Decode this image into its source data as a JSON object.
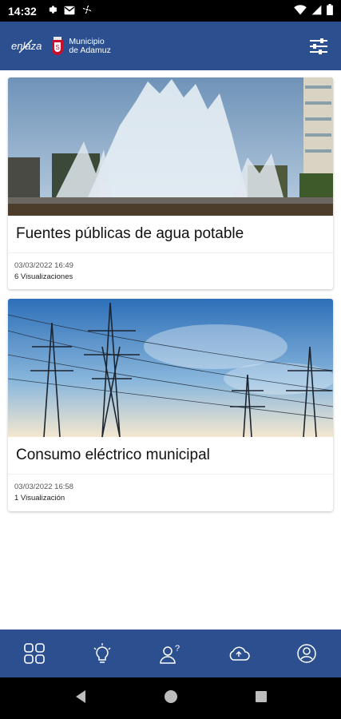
{
  "status_bar": {
    "time": "14:32",
    "left_icons": [
      "gear-icon",
      "gmail-icon",
      "fan-icon"
    ],
    "right_icons": [
      "wifi-icon",
      "signal-icon",
      "battery-icon"
    ]
  },
  "app_bar": {
    "logo_text": "enlaza",
    "municipality_line1": "Municipio",
    "municipality_line2": "de Adamuz",
    "filter_icon": "sliders-icon",
    "color": "#2b4f8f"
  },
  "cards": [
    {
      "image": "fountains-photo",
      "title": "Fuentes públicas de agua potable",
      "date": "03/03/2022 16:49",
      "views": "6 Visualizaciones"
    },
    {
      "image": "power-lines-photo",
      "title": "Consumo eléctrico municipal",
      "date": "03/03/2022 16:58",
      "views": "1 Visualización"
    }
  ],
  "bottom_nav": {
    "items": [
      "grid-icon",
      "lightbulb-icon",
      "user-question-icon",
      "cloud-upload-icon",
      "account-icon"
    ]
  },
  "system_nav": {
    "items": [
      "back-icon",
      "home-icon",
      "recents-icon"
    ]
  }
}
